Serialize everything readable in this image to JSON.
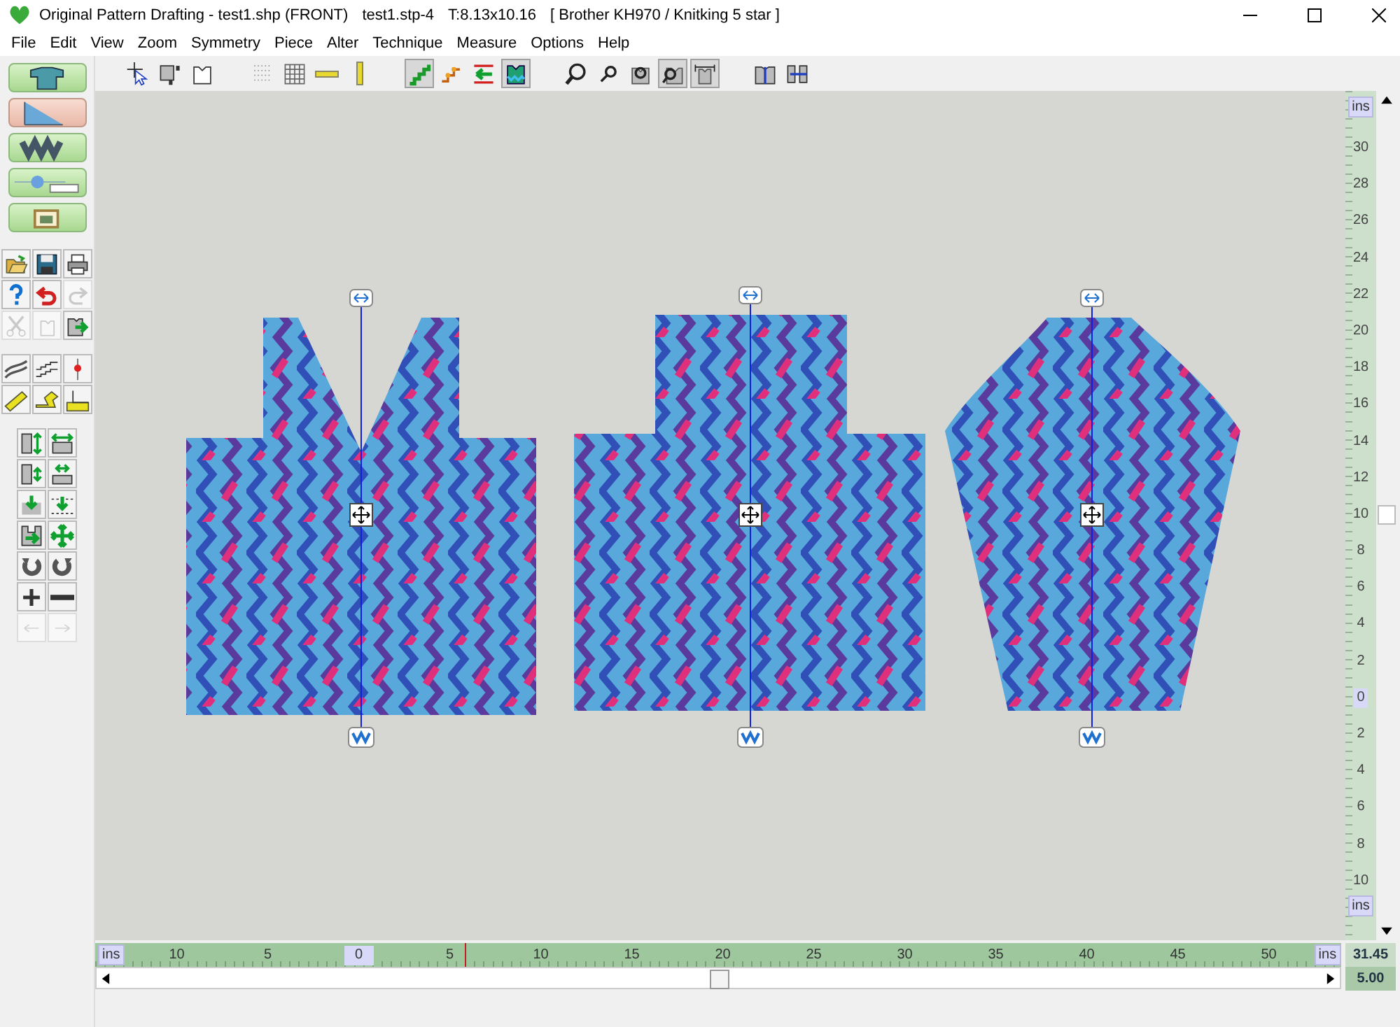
{
  "window": {
    "title_parts": [
      "Original Pattern Drafting - test1.shp (FRONT)",
      "test1.stp-4",
      "T:8.13x10.16",
      "[ Brother KH970 / Knitking 5 star ]"
    ]
  },
  "menu": [
    "File",
    "Edit",
    "View",
    "Zoom",
    "Symmetry",
    "Piece",
    "Alter",
    "Technique",
    "Measure",
    "Options",
    "Help"
  ],
  "toolbar": [
    [
      {
        "kind": "select",
        "pressed": false
      },
      {
        "kind": "number-piece",
        "pressed": false
      },
      {
        "kind": "bodice-outline",
        "pressed": false
      }
    ],
    [
      {
        "kind": "dot-grid",
        "pressed": false
      },
      {
        "kind": "grid",
        "pressed": false
      },
      {
        "kind": "h-ruler",
        "pressed": false
      },
      {
        "kind": "v-ruler",
        "pressed": false
      }
    ],
    [
      {
        "kind": "stairs",
        "pressed": true
      },
      {
        "kind": "stair-dots",
        "pressed": false
      },
      {
        "kind": "arrow-lines",
        "pressed": false
      },
      {
        "kind": "bodice-filled",
        "pressed": true
      }
    ],
    [
      {
        "kind": "zoom",
        "pressed": false
      },
      {
        "kind": "zoom-small",
        "pressed": false
      },
      {
        "kind": "zoom-piece",
        "pressed": false
      },
      {
        "kind": "zoom-window",
        "pressed": true
      },
      {
        "kind": "zoom-fit",
        "pressed": true
      }
    ],
    [
      {
        "kind": "split",
        "pressed": false
      },
      {
        "kind": "join",
        "pressed": false
      }
    ]
  ],
  "modes": [
    {
      "kind": "sweater",
      "selected": false
    },
    {
      "kind": "slope",
      "selected": true
    },
    {
      "kind": "pieces",
      "selected": false
    },
    {
      "kind": "machine",
      "selected": false
    },
    {
      "kind": "picture",
      "selected": false
    }
  ],
  "tool_groups": [
    [
      {
        "kind": "open",
        "disabled": false
      },
      {
        "kind": "save",
        "disabled": false
      },
      {
        "kind": "print",
        "disabled": false
      },
      {
        "kind": "help",
        "disabled": false
      },
      {
        "kind": "undo",
        "disabled": false
      },
      {
        "kind": "redo",
        "disabled": true
      },
      {
        "kind": "cut",
        "disabled": true
      },
      {
        "kind": "copy",
        "disabled": true
      },
      {
        "kind": "export",
        "disabled": false
      }
    ],
    [
      {
        "kind": "smooth",
        "disabled": false
      },
      {
        "kind": "stepped",
        "disabled": false
      },
      {
        "kind": "point-line",
        "disabled": false
      },
      {
        "kind": "tape",
        "disabled": false
      },
      {
        "kind": "tape-twist",
        "disabled": false
      },
      {
        "kind": "gauge",
        "disabled": false
      }
    ],
    [
      {
        "kind": "stretch-v",
        "disabled": false
      },
      {
        "kind": "stretch-h",
        "disabled": false
      },
      {
        "kind": "shrink-v",
        "disabled": false
      },
      {
        "kind": "shrink-h",
        "disabled": false
      },
      {
        "kind": "drop",
        "disabled": false
      },
      {
        "kind": "drop-line",
        "disabled": false
      },
      {
        "kind": "shift",
        "disabled": false
      },
      {
        "kind": "move-all",
        "disabled": false
      },
      {
        "kind": "rotate-cw",
        "disabled": false
      },
      {
        "kind": "rotate-ccw",
        "disabled": false
      },
      {
        "kind": "plus",
        "disabled": false
      },
      {
        "kind": "minus",
        "disabled": false
      },
      {
        "kind": "prev-point",
        "disabled": true
      },
      {
        "kind": "next-point",
        "disabled": true
      }
    ]
  ],
  "vertical_ruler": {
    "unit_top": "ins",
    "unit_bottom": "ins",
    "labels": [
      {
        "text": "30",
        "origin": false
      },
      {
        "text": "28",
        "origin": false
      },
      {
        "text": "26",
        "origin": false
      },
      {
        "text": "24",
        "origin": false
      },
      {
        "text": "22",
        "origin": false
      },
      {
        "text": "20",
        "origin": false
      },
      {
        "text": "18",
        "origin": false
      },
      {
        "text": "16",
        "origin": false
      },
      {
        "text": "14",
        "origin": false
      },
      {
        "text": "12",
        "origin": false
      },
      {
        "text": "10",
        "origin": false
      },
      {
        "text": "8",
        "origin": false
      },
      {
        "text": "6",
        "origin": false
      },
      {
        "text": "4",
        "origin": false
      },
      {
        "text": "2",
        "origin": false
      },
      {
        "text": "0",
        "origin": true
      },
      {
        "text": "2",
        "origin": false
      },
      {
        "text": "4",
        "origin": false
      },
      {
        "text": "6",
        "origin": false
      },
      {
        "text": "8",
        "origin": false
      },
      {
        "text": "10",
        "origin": false
      }
    ]
  },
  "horizontal_ruler": {
    "unit_left": "ins",
    "unit_right": "ins",
    "labels": [
      {
        "text": "10",
        "origin": false
      },
      {
        "text": "5",
        "origin": false
      },
      {
        "text": "0",
        "origin": true
      },
      {
        "text": "5",
        "origin": false
      },
      {
        "text": "10",
        "origin": false
      },
      {
        "text": "15",
        "origin": false
      },
      {
        "text": "20",
        "origin": false
      },
      {
        "text": "25",
        "origin": false
      },
      {
        "text": "30",
        "origin": false
      },
      {
        "text": "35",
        "origin": false
      },
      {
        "text": "40",
        "origin": false
      },
      {
        "text": "45",
        "origin": false
      },
      {
        "text": "50",
        "origin": false
      }
    ]
  },
  "readouts": [
    "31.45",
    "5.00"
  ],
  "pieces": [
    {
      "kind": "front"
    },
    {
      "kind": "back"
    },
    {
      "kind": "sleeve"
    }
  ]
}
